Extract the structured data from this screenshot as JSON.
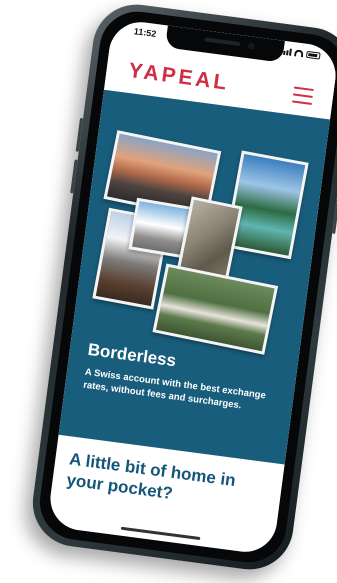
{
  "status_bar": {
    "time": "11:52"
  },
  "header": {
    "logo": "YAPEAL",
    "menu_icon": "hamburger-icon"
  },
  "hero": {
    "title": "Borderless",
    "description": "A Swiss account with the best exchange rates, without fees and surcharges."
  },
  "section": {
    "title": "A little bit of home in your pocket?"
  },
  "colors": {
    "brand": "#cf2e45",
    "hero_background": "#195d7c",
    "heading": "#14567a"
  }
}
